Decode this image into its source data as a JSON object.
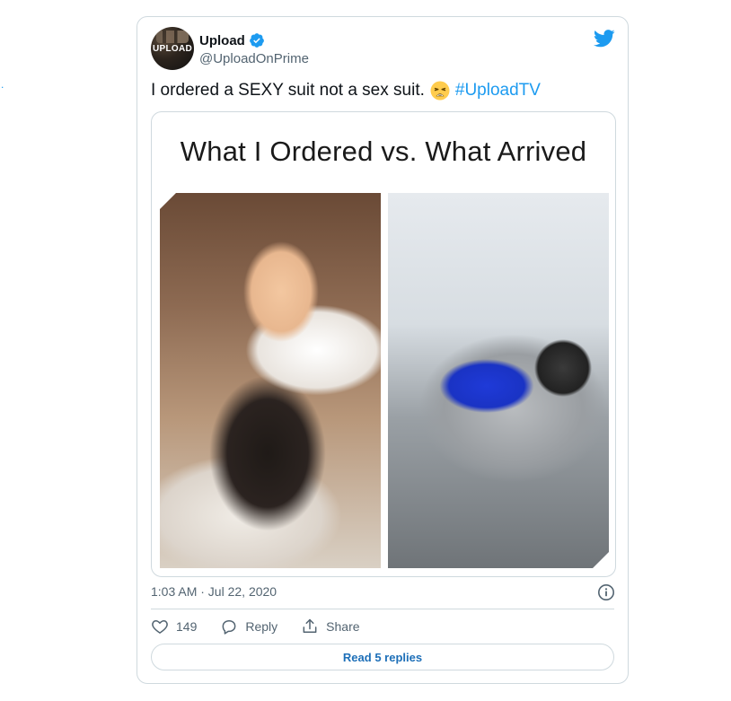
{
  "tweet": {
    "display_name": "Upload",
    "handle": "@UploadOnPrime",
    "avatar_text": "UPLOAD",
    "text": "I ordered a SEXY suit not a sex suit.",
    "hashtag": "#UploadTV",
    "emoji": "weary-face-emoji",
    "media_caption": "What I Ordered vs. What Arrived",
    "timestamp": "1:03 AM · Jul 22, 2020",
    "likes": "149",
    "reply_label": "Reply",
    "share_label": "Share",
    "read_replies_label": "Read 5 replies"
  },
  "icons": {
    "verified": "verified-badge-icon",
    "brand": "twitter-bird-icon",
    "like": "heart-icon",
    "reply": "speech-bubble-icon",
    "share": "share-icon",
    "info": "info-icon"
  },
  "colors": {
    "accent": "#1d9bf0",
    "text_secondary": "#536471",
    "border": "#cfd9de"
  }
}
